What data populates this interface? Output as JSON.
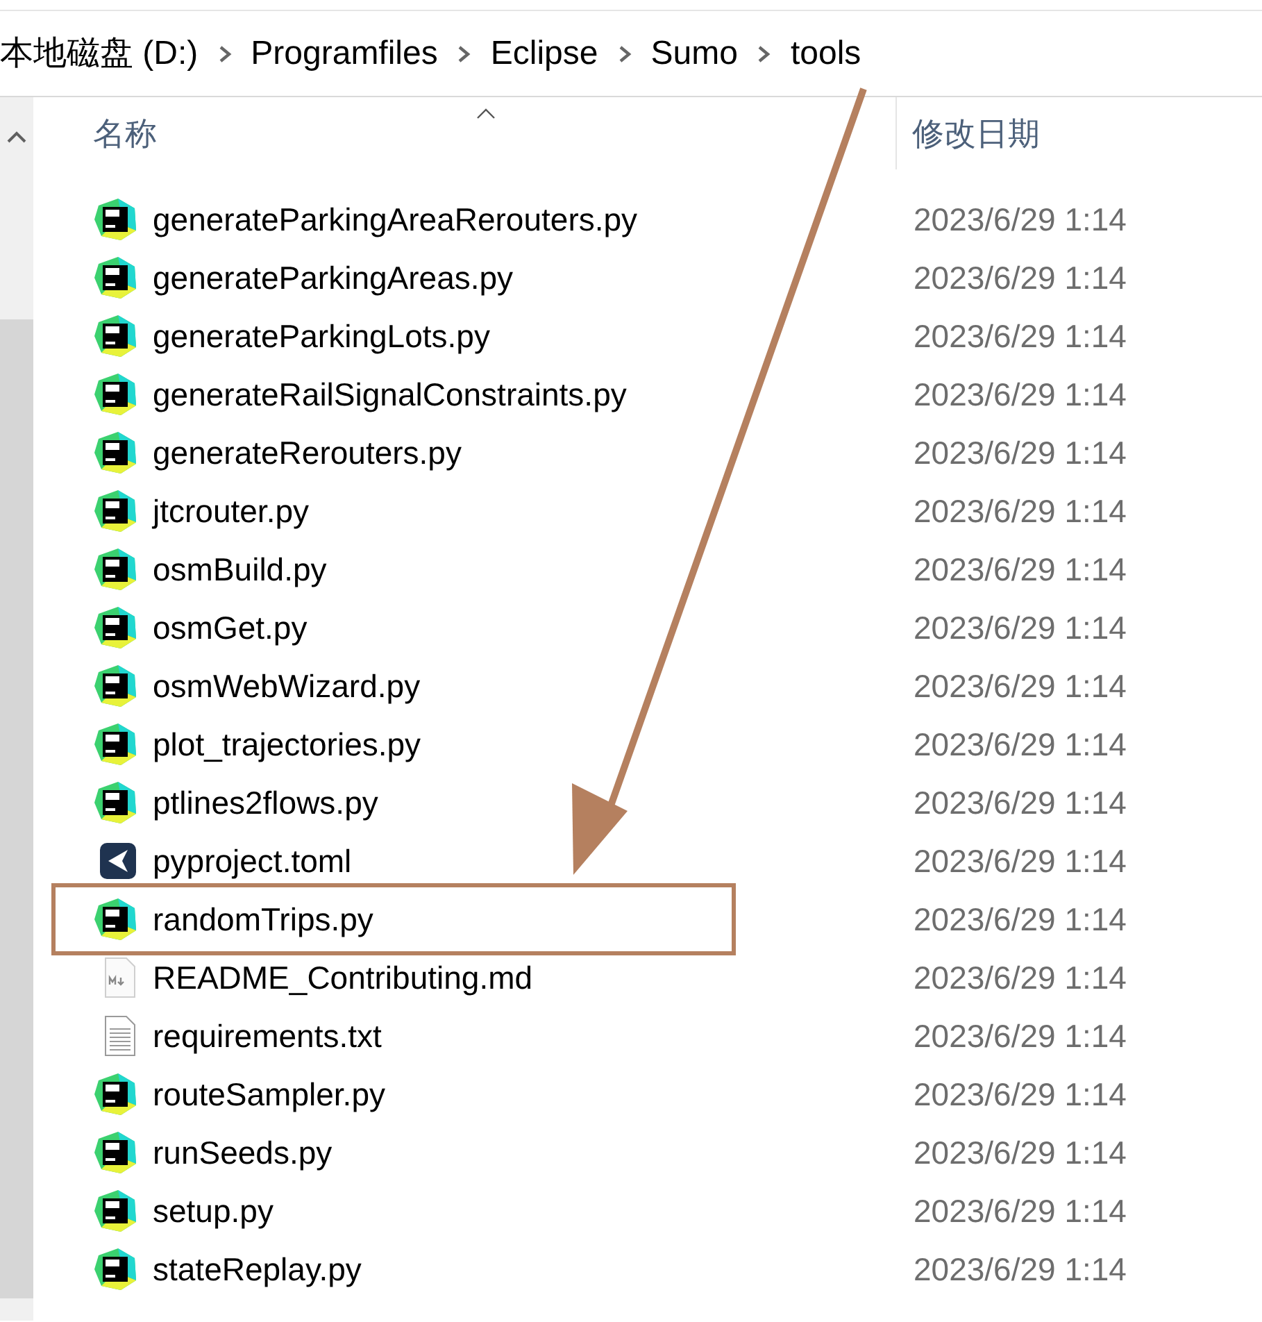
{
  "breadcrumb": [
    "本地磁盘 (D:)",
    "Programfiles",
    "Eclipse",
    "Sumo",
    "tools"
  ],
  "columns": [
    {
      "label": "名称"
    },
    {
      "label": "修改日期"
    }
  ],
  "files": [
    {
      "name": "generateParkingAreaRerouters.py",
      "kind": "python",
      "modified": "2023/6/29 1:14",
      "highlighted": false
    },
    {
      "name": "generateParkingAreas.py",
      "kind": "python",
      "modified": "2023/6/29 1:14",
      "highlighted": false
    },
    {
      "name": "generateParkingLots.py",
      "kind": "python",
      "modified": "2023/6/29 1:14",
      "highlighted": false
    },
    {
      "name": "generateRailSignalConstraints.py",
      "kind": "python",
      "modified": "2023/6/29 1:14",
      "highlighted": false
    },
    {
      "name": "generateRerouters.py",
      "kind": "python",
      "modified": "2023/6/29 1:14",
      "highlighted": false
    },
    {
      "name": "jtcrouter.py",
      "kind": "python",
      "modified": "2023/6/29 1:14",
      "highlighted": false
    },
    {
      "name": "osmBuild.py",
      "kind": "python",
      "modified": "2023/6/29 1:14",
      "highlighted": false
    },
    {
      "name": "osmGet.py",
      "kind": "python",
      "modified": "2023/6/29 1:14",
      "highlighted": false
    },
    {
      "name": "osmWebWizard.py",
      "kind": "python",
      "modified": "2023/6/29 1:14",
      "highlighted": false
    },
    {
      "name": "plot_trajectories.py",
      "kind": "python",
      "modified": "2023/6/29 1:14",
      "highlighted": false
    },
    {
      "name": "ptlines2flows.py",
      "kind": "python",
      "modified": "2023/6/29 1:14",
      "highlighted": false
    },
    {
      "name": "pyproject.toml",
      "kind": "toml",
      "modified": "2023/6/29 1:14",
      "highlighted": false
    },
    {
      "name": "randomTrips.py",
      "kind": "python",
      "modified": "2023/6/29 1:14",
      "highlighted": true
    },
    {
      "name": "README_Contributing.md",
      "kind": "markdown",
      "modified": "2023/6/29 1:14",
      "highlighted": false
    },
    {
      "name": "requirements.txt",
      "kind": "text",
      "modified": "2023/6/29 1:14",
      "highlighted": false
    },
    {
      "name": "routeSampler.py",
      "kind": "python",
      "modified": "2023/6/29 1:14",
      "highlighted": false
    },
    {
      "name": "runSeeds.py",
      "kind": "python",
      "modified": "2023/6/29 1:14",
      "highlighted": false
    },
    {
      "name": "setup.py",
      "kind": "python",
      "modified": "2023/6/29 1:14",
      "highlighted": false
    },
    {
      "name": "stateReplay.py",
      "kind": "python",
      "modified": "2023/6/29 1:14",
      "highlighted": false
    }
  ]
}
